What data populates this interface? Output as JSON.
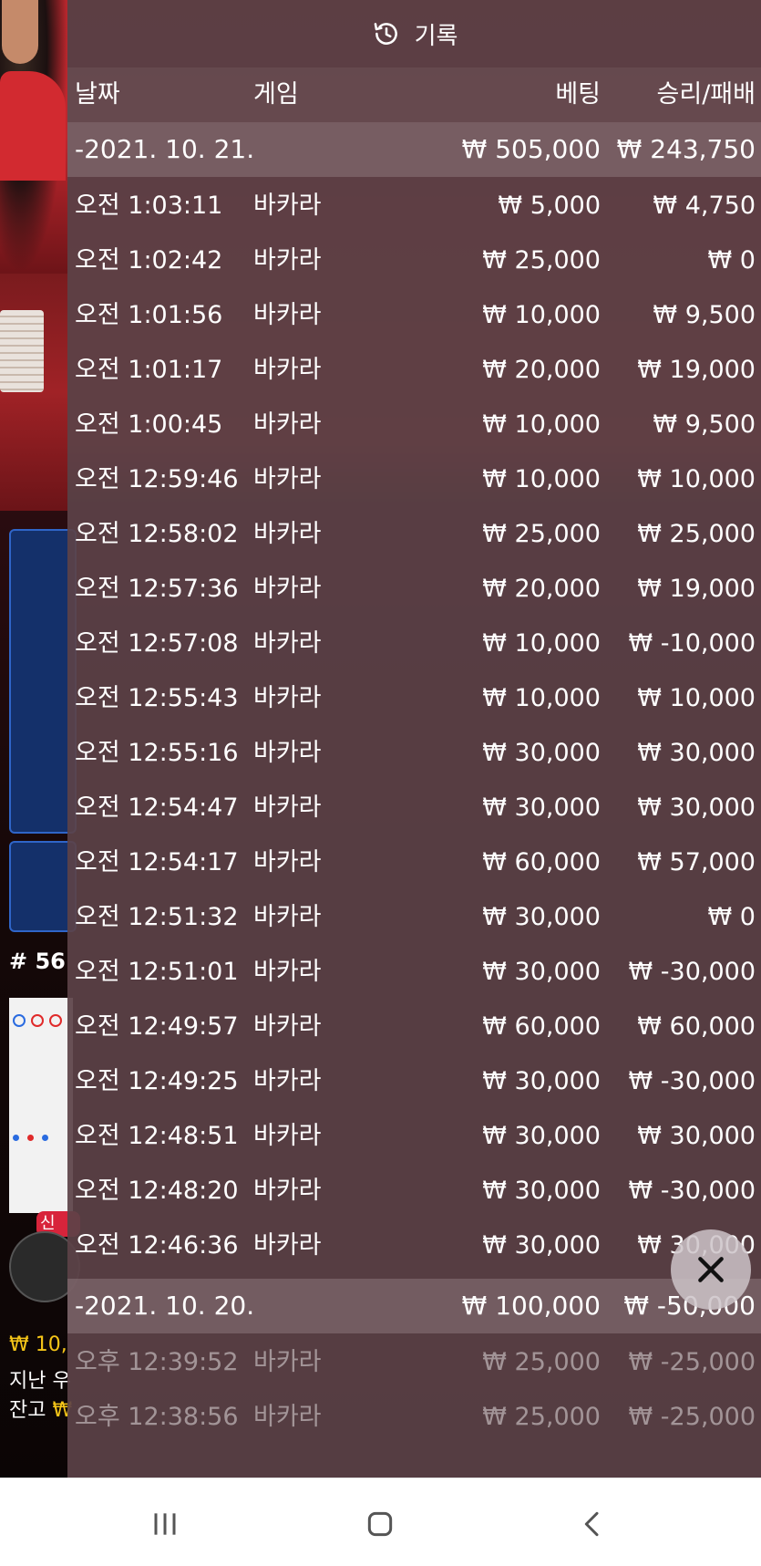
{
  "history": {
    "title": "기록",
    "icon": "history-clock-icon",
    "columns": {
      "date": "날짜",
      "game": "게임",
      "bet": "베팅",
      "result": "승리/패배"
    },
    "days": [
      {
        "date": "-2021. 10. 21.",
        "bet_total": "₩ 505,000",
        "result_total": "₩ 243,750",
        "rows": [
          {
            "time": "오전 1:03:11",
            "game": "바카라",
            "bet": "₩ 5,000",
            "result": "₩ 4,750"
          },
          {
            "time": "오전 1:02:42",
            "game": "바카라",
            "bet": "₩ 25,000",
            "result": "₩ 0"
          },
          {
            "time": "오전 1:01:56",
            "game": "바카라",
            "bet": "₩ 10,000",
            "result": "₩ 9,500"
          },
          {
            "time": "오전 1:01:17",
            "game": "바카라",
            "bet": "₩ 20,000",
            "result": "₩ 19,000"
          },
          {
            "time": "오전 1:00:45",
            "game": "바카라",
            "bet": "₩ 10,000",
            "result": "₩ 9,500"
          },
          {
            "time": "오전 12:59:46",
            "game": "바카라",
            "bet": "₩ 10,000",
            "result": "₩ 10,000"
          },
          {
            "time": "오전 12:58:02",
            "game": "바카라",
            "bet": "₩ 25,000",
            "result": "₩ 25,000"
          },
          {
            "time": "오전 12:57:36",
            "game": "바카라",
            "bet": "₩ 20,000",
            "result": "₩ 19,000"
          },
          {
            "time": "오전 12:57:08",
            "game": "바카라",
            "bet": "₩ 10,000",
            "result": "₩ -10,000"
          },
          {
            "time": "오전 12:55:43",
            "game": "바카라",
            "bet": "₩ 10,000",
            "result": "₩ 10,000"
          },
          {
            "time": "오전 12:55:16",
            "game": "바카라",
            "bet": "₩ 30,000",
            "result": "₩ 30,000"
          },
          {
            "time": "오전 12:54:47",
            "game": "바카라",
            "bet": "₩ 30,000",
            "result": "₩ 30,000"
          },
          {
            "time": "오전 12:54:17",
            "game": "바카라",
            "bet": "₩ 60,000",
            "result": "₩ 57,000"
          },
          {
            "time": "오전 12:51:32",
            "game": "바카라",
            "bet": "₩ 30,000",
            "result": "₩ 0"
          },
          {
            "time": "오전 12:51:01",
            "game": "바카라",
            "bet": "₩ 30,000",
            "result": "₩ -30,000"
          },
          {
            "time": "오전 12:49:57",
            "game": "바카라",
            "bet": "₩ 60,000",
            "result": "₩ 60,000"
          },
          {
            "time": "오전 12:49:25",
            "game": "바카라",
            "bet": "₩ 30,000",
            "result": "₩ -30,000"
          },
          {
            "time": "오전 12:48:51",
            "game": "바카라",
            "bet": "₩ 30,000",
            "result": "₩ 30,000"
          },
          {
            "time": "오전 12:48:20",
            "game": "바카라",
            "bet": "₩ 30,000",
            "result": "₩ -30,000"
          },
          {
            "time": "오전 12:46:36",
            "game": "바카라",
            "bet": "₩ 30,000",
            "result": "₩ 30,000"
          }
        ]
      },
      {
        "date": "-2021. 10. 20.",
        "bet_total": "₩ 100,000",
        "result_total": "₩ -50,000",
        "rows": [
          {
            "time": "오후 12:39:52",
            "game": "바카라",
            "bet": "₩ 25,000",
            "result": "₩ -25,000"
          },
          {
            "time": "오후 12:38:56",
            "game": "바카라",
            "bet": "₩ 25,000",
            "result": "₩ -25,000"
          }
        ]
      }
    ]
  },
  "background": {
    "round_number": "# 56",
    "new_badge": "신",
    "balance_line1": "₩ 10,",
    "balance_line2": "지난 우",
    "balance_line3_label": "잔고",
    "balance_line3_currency": "₩"
  },
  "close_button_icon": "close-icon",
  "nav": {
    "recent_icon": "recent-apps-icon",
    "home_icon": "home-icon",
    "back_icon": "back-icon"
  },
  "colors": {
    "overlay": "#5c4248",
    "day_row": "#8c767c",
    "accent_gold": "#f5c518",
    "badge_red": "#d8243b",
    "panel_blue": "#2f65c8"
  }
}
